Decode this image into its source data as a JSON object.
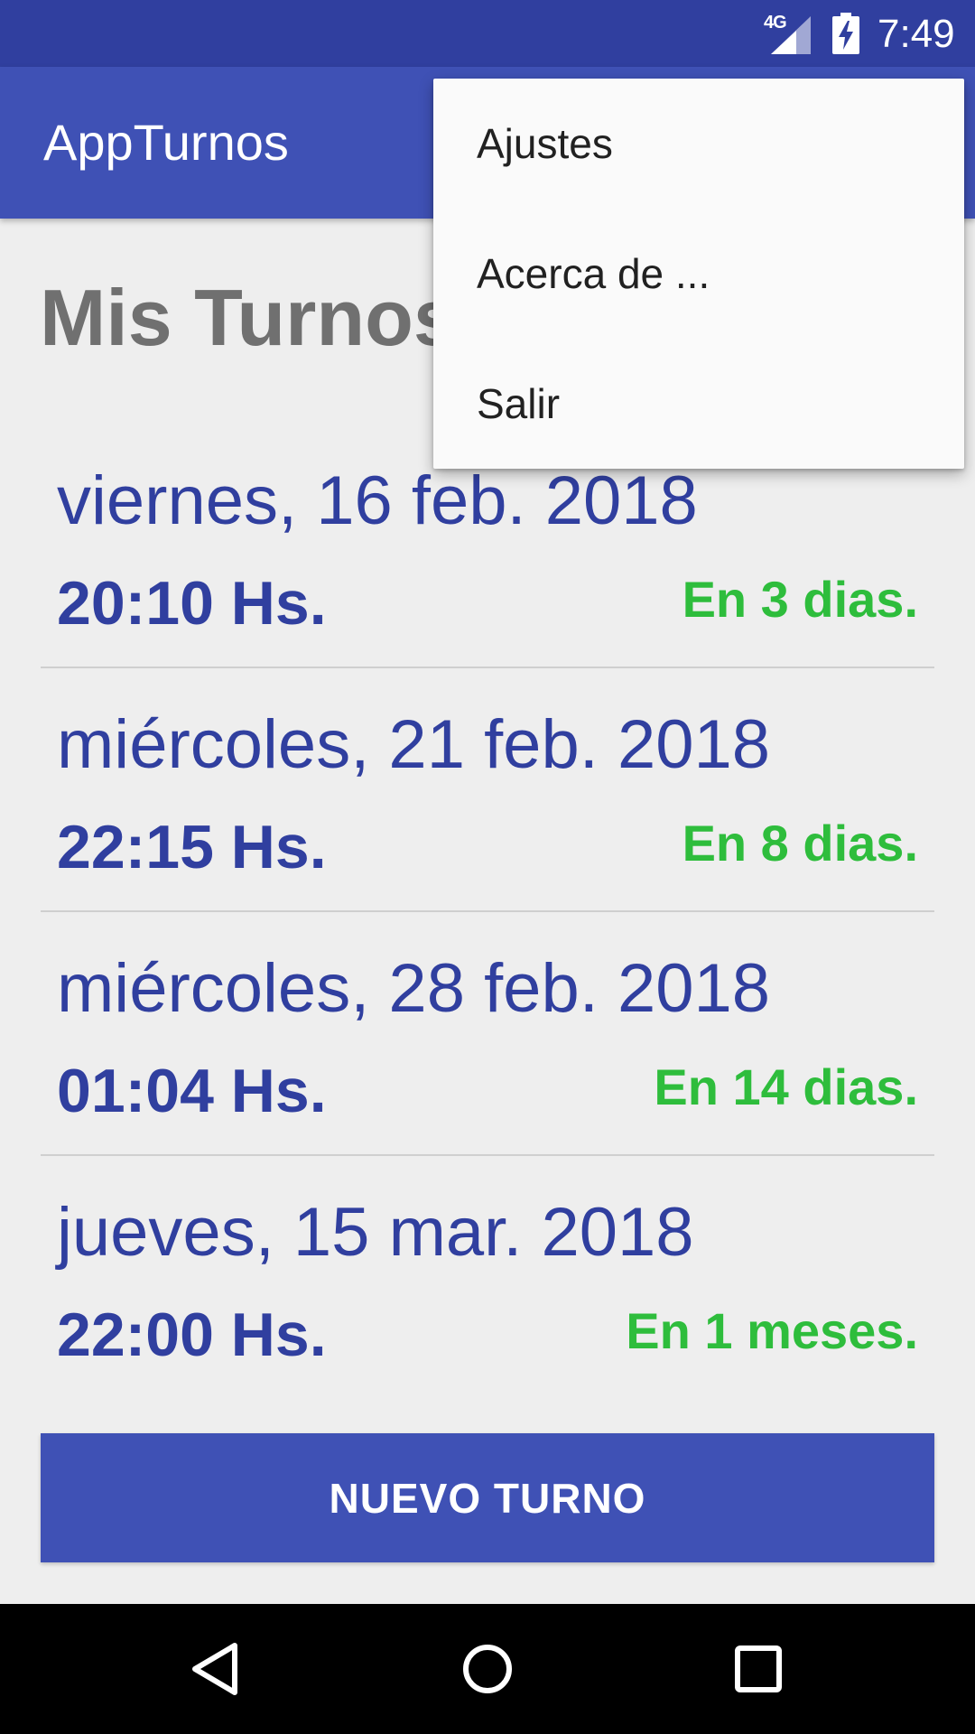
{
  "status_bar": {
    "network": "4G",
    "time": "7:49"
  },
  "app_bar": {
    "title": "AppTurnos"
  },
  "page": {
    "title": "Mis Turnos"
  },
  "turnos": [
    {
      "fecha": "viernes, 16 feb. 2018",
      "hora": "20:10 Hs.",
      "faltan": "En 3 dias."
    },
    {
      "fecha": "miércoles, 21 feb. 2018",
      "hora": "22:15 Hs.",
      "faltan": "En 8 dias."
    },
    {
      "fecha": "miércoles, 28 feb. 2018",
      "hora": "01:04 Hs.",
      "faltan": "En 14 dias."
    },
    {
      "fecha": "jueves, 15 mar. 2018",
      "hora": "22:00 Hs.",
      "faltan": "En 1 meses."
    }
  ],
  "actions": {
    "nuevo_turno": "NUEVO TURNO"
  },
  "menu": {
    "items": [
      "Ajustes",
      "Acerca de ...",
      "Salir"
    ]
  },
  "icons": {
    "network": "signal-icon",
    "battery": "battery-charging-icon",
    "back": "back-icon",
    "home": "home-icon",
    "recents": "recents-icon"
  },
  "colors": {
    "primary": "#3f51b5",
    "primary_dark": "#303f9f",
    "accent_green": "#2ebd3c",
    "background": "#eeeeee"
  }
}
